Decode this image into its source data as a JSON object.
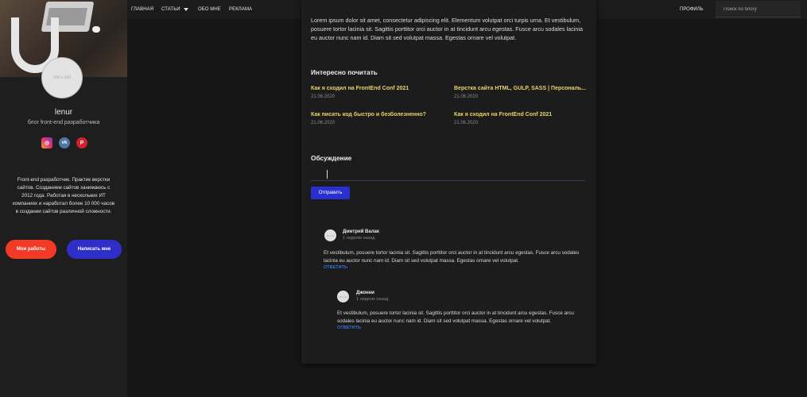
{
  "nav": {
    "items": [
      "ГЛАВНАЯ",
      "СТАТЬИ",
      "ОБО МНЕ",
      "РЕКЛАМА"
    ],
    "profile": "ПРОФИЛЬ",
    "search_placeholder": "Поиск по блогу"
  },
  "sidebar": {
    "avatar_text": "100 x 100",
    "name": "lenur",
    "subtitle": "блог front-end разработчика",
    "socials": [
      "instagram-icon",
      "vk-icon",
      "pinterest-icon"
    ],
    "bio": "Front-end разработчик. Практик верстки сайтов. Созданием сайтов занимаюсь с 2012 года. Работая в нескольких ИТ компаниях и наработал более 10 000 часов в создании сайтов различной сложности.",
    "btn_works": "Мои работы",
    "btn_write": "Написать мне"
  },
  "article": {
    "lorem": "Lorem ipsum dolor sit amet, consectetur adipiscing elit. Elementum volutpat orci turpis urna. Et vestibulum, posuere tortor lacinia sit. Sagittis porttitor orci auctor in at tincidunt arcu egestas. Fusce arcu sodales lacinia eu auctor nunc nam id. Diam sit sed volutpat massa. Egestas ornare vel volutpat."
  },
  "related": {
    "title": "Интересно почитать",
    "items": [
      {
        "title": "Как я сходил на FrontEnd Conf 2021",
        "date": "21.06.2020"
      },
      {
        "title": "Верстка сайта HTML, GULP, SASS | Персональ...",
        "date": "21.06.2020"
      },
      {
        "title": "Как писать код быстро и безболезненно?",
        "date": "21.06.2020"
      },
      {
        "title": "Как я сходил на FrontEnd Conf 2021",
        "date": "21.06.2020"
      }
    ]
  },
  "discussion": {
    "title": "Обсуждение",
    "send_label": "Отправить",
    "comments": [
      {
        "avatar_text": "30 x 30",
        "author": "Дмитрий Валак",
        "time": "1 неделю назад",
        "text": "Et vestibulum, posuere tortor lacinia sit. Sagittis porttitor orci auctor in at tincidunt arcu egestas. Fusce arcu sodales lacinia eu auctor nunc nam id. Diam sit sed volutpat massa. Egestas ornare vel volutpat.",
        "reply": "ОТВЕТИТЬ"
      },
      {
        "avatar_text": "30 x 30",
        "author": "Джонни",
        "time": "1 неделю назад",
        "text": "Et vestibulum, posuere tortor lacinia sit. Sagittis porttitor orci auctor in at tincidunt arcu egestas. Fusce arcu sodales lacinia eu auctor nunc nam id. Diam sit sed volutpat massa. Egestas ornare vel volutpat.",
        "reply": "ОТВЕТИТЬ"
      }
    ]
  },
  "colors": {
    "accent_red": "#f23a26",
    "accent_blue": "#2e2fc8",
    "link_yellow": "#e9d36b",
    "reply_blue": "#3a6fd8"
  }
}
